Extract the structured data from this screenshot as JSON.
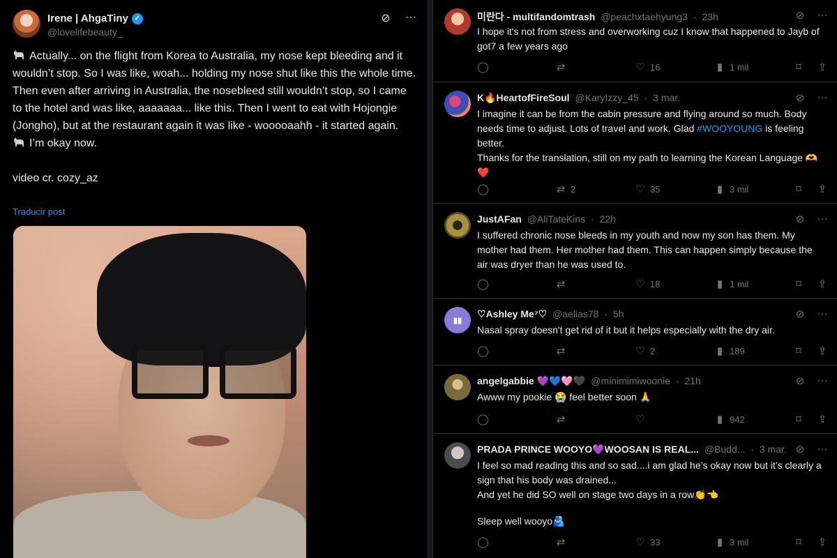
{
  "post": {
    "author_name": "Irene | AhgaTiny",
    "author_handle": "@lovelifebeauty_",
    "paragraph1": "Actually... on the flight from Korea to Australia, my nose kept bleeding and it wouldn’t stop. So I was like, woah... holding my nose shut like this the whole time. Then even after arriving in Australia, the nosebleed still wouldn’t stop, so I came to the hotel and was like, aaaaaaa... like this. Then I went to eat with Hojongie (Jongho), but at the restaurant again it was like - wooooaahh - it started again.",
    "paragraph2": "I’m okay now.",
    "credit": "video cr. cozy_az",
    "translate_label": "Traducir post",
    "icons": [
      "grok-icon",
      "more-icon",
      "black-cat-icon"
    ]
  },
  "replies": [
    {
      "name": "미란다 - multifandomtrash",
      "handle": "@peachxtaehyung3",
      "time": "23h",
      "lines": [
        "I hope it's not from stress and overworking cuz I know that happened to Jayb of got7 a few years ago"
      ],
      "replies_count": "",
      "retweets": "",
      "likes": "16",
      "views": "1 mil",
      "avatar_color": "#b23a2e"
    },
    {
      "name": "K🔥HeartofFireSoul",
      "handle": "@KaryIzzy_45",
      "time": "3 mar.",
      "text_before_tag": "I imagine it can be from the cabin pressure and  flying around so much. Body needs time to adjust. Lots of travel and work. Glad ",
      "hashtag": "#WOOYOUNG",
      "text_after_tag": " is feeling better.",
      "line2": "Thanks for the translation, still on my path to learning the Korean Language 🫶❤️",
      "replies_count": "",
      "retweets": "2",
      "likes": "35",
      "views": "3 mil",
      "avatar_color": "#3b4fb8"
    },
    {
      "name": "JustAFan",
      "handle": "@AliTateKins",
      "time": "22h",
      "lines": [
        "I suffered chronic nose bleeds in my youth and now my son has them. My mother had them. Her mother had them. This can happen simply because the air was dryer than he was used to."
      ],
      "replies_count": "",
      "retweets": "",
      "likes": "18",
      "views": "1 mil",
      "avatar_color": "#6b5a2a"
    },
    {
      "name": "♡Ashley Me⁷♡",
      "handle": "@aelias78",
      "time": "5h",
      "lines": [
        "Nasal spray doesn't get rid of it but it helps especially with the dry air."
      ],
      "replies_count": "",
      "retweets": "",
      "likes": "2",
      "views": "189",
      "avatar_color": "#8b7bd8"
    },
    {
      "name": "angelgabbie 💜💙🩷🖤",
      "handle": "@minimimiwoonie",
      "time": "21h",
      "lines": [
        "Awww my pookie 😭 feel better soon 🙏"
      ],
      "replies_count": "",
      "retweets": "",
      "likes": "",
      "views": "942",
      "avatar_color": "#7a6a3a"
    },
    {
      "name": "PRADA PRINCE WOOYO💜WOOSAN IS REAL...",
      "handle": "@Budd...",
      "time": "3 mar.",
      "lines": [
        "I feel so mad reading this and so sad....i am glad he’s okay now but it’s clearly a sign that his body was drained...",
        "And yet he did SO well on stage two days in a row👏👈",
        "",
        "Sleep well wooyo🫂"
      ],
      "replies_count": "",
      "retweets": "",
      "likes": "33",
      "views": "3 mil",
      "avatar_color": "#4a4a52"
    }
  ],
  "icons": {
    "grok": "grok-icon",
    "more": "more-icon",
    "reply": "reply-icon",
    "retweet": "retweet-icon",
    "like": "heart-icon",
    "views": "views-icon",
    "bookmark": "bookmark-icon",
    "share": "share-icon"
  },
  "colors": {
    "accent": "#1d9bf0",
    "muted": "#71767b",
    "text": "#e7e9ea",
    "border": "#2f3336"
  }
}
